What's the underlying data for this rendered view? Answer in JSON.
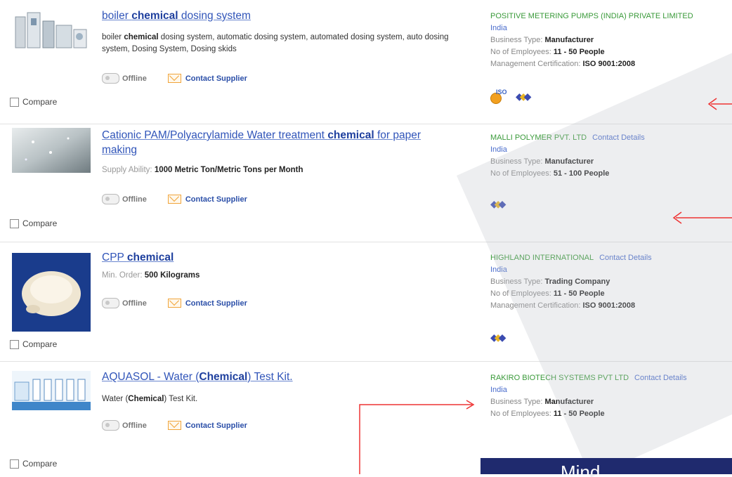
{
  "listings": [
    {
      "title_pre": "boiler ",
      "title_key": "chemical",
      "title_post": " dosing system",
      "desc_pre": "boiler ",
      "desc_key": "chemical",
      "desc_post": " dosing system, automatic dosing system, automated dosing system, auto dosing system, Dosing System, Dosing skids",
      "supplier": "POSITIVE METERING PUMPS (INDIA) PRIVATE LIMITED",
      "country": "India",
      "business_type_label": "Business Type:",
      "business_type": "Manufacturer",
      "employees_label": "No of Employees:",
      "employees": "11 - 50 People",
      "cert_label": "Management Certification:",
      "cert": "ISO 9001:2008",
      "badge_iso": "ISO",
      "status": "Offline",
      "contact": "Contact Supplier",
      "compare": "Compare"
    },
    {
      "title_pre": "Cationic PAM/Polyacrylamide Water treatment ",
      "title_key": "chemical",
      "title_post": " for paper making",
      "desc_label": "Supply Ability:",
      "desc_value": "1000 Metric Ton/Metric Tons per Month",
      "supplier": "MALLI POLYMER PVT. LTD",
      "contact_details": "Contact Details",
      "country": "India",
      "business_type_label": "Business Type:",
      "business_type": "Manufacturer",
      "employees_label": "No of Employees:",
      "employees": "51 - 100 People",
      "status": "Offline",
      "contact": "Contact Supplier",
      "compare": "Compare"
    },
    {
      "title_pre": "CPP ",
      "title_key": "chemical",
      "title_post": "",
      "desc_label": "Min. Order:",
      "desc_value": "500 Kilograms",
      "supplier": "HIGHLAND INTERNATIONAL",
      "contact_details": "Contact Details",
      "country": "India",
      "business_type_label": "Business Type:",
      "business_type": "Trading Company",
      "employees_label": "No of Employees:",
      "employees": "11 - 50 People",
      "cert_label": "Management Certification:",
      "cert": "ISO 9001:2008",
      "status": "Offline",
      "contact": "Contact Supplier",
      "compare": "Compare"
    },
    {
      "title_pre": "AQUASOL - Water (",
      "title_key": "Chemical",
      "title_post": ") Test Kit.",
      "desc_pre": "Water (",
      "desc_key": "Chemical",
      "desc_post": ") Test Kit.",
      "supplier": "RAKIRO BIOTECH SYSTEMS PVT LTD",
      "contact_details": "Contact Details",
      "country": "India",
      "business_type_label": "Business Type:",
      "business_type": "Manufacturer",
      "employees_label": "No of Employees:",
      "employees": "11 - 50 People",
      "status": "Offline",
      "contact": "Contact Supplier",
      "compare": "Compare"
    }
  ],
  "banner": {
    "text": "Mind"
  },
  "colors": {
    "link": "#3155b9",
    "supplier": "#3a9a3a",
    "annotation": "#ee3333",
    "banner": "#1f2a6e"
  }
}
